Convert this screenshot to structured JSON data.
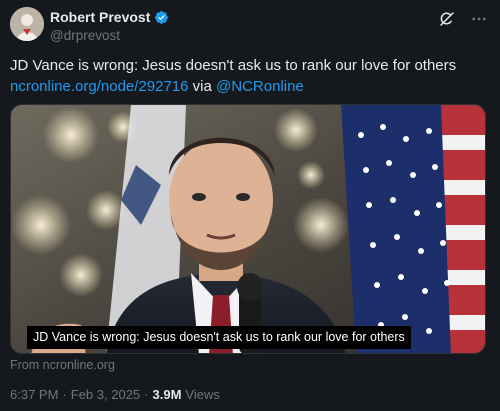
{
  "author": {
    "display_name": "Robert Prevost",
    "handle": "@drprevost",
    "verified": true
  },
  "tweet": {
    "text": "JD Vance is wrong: Jesus doesn't ask us to rank our love for others",
    "link_text": "ncronline.org/node/292716",
    "via_text": "via",
    "mention": "@NCRonline"
  },
  "media": {
    "caption": "JD Vance is wrong: Jesus doesn't ask us to rank our love for others",
    "source": "From ncronline.org"
  },
  "meta": {
    "time": "6:37 PM",
    "separator": "·",
    "date": "Feb 3, 2025",
    "views_count": "3.9M",
    "views_label": "Views"
  },
  "icons": {
    "verified": "verified-badge-icon",
    "grok": "grok-icon",
    "more": "more-icon"
  },
  "colors": {
    "link": "#1d9bf0",
    "background": "#15181c",
    "text": "#e7e9ea",
    "muted": "#71767b"
  }
}
